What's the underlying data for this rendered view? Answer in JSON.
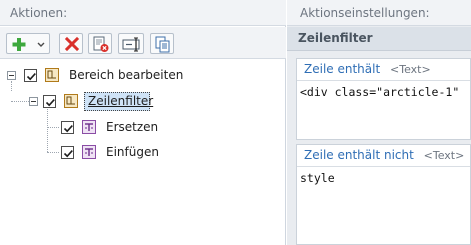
{
  "left": {
    "header": "Aktionen:",
    "tree": {
      "root": {
        "label": "Bereich bearbeiten",
        "checked": true,
        "expanded": true
      },
      "child": {
        "label": "Zeilenfilter",
        "checked": true,
        "expanded": true,
        "selected": true
      },
      "grandchildren": [
        {
          "label": "Ersetzen",
          "checked": true
        },
        {
          "label": "Einfügen",
          "checked": true
        }
      ]
    },
    "toolbar": [
      {
        "name": "add-dropdown",
        "icon": "plus-icon"
      },
      {
        "name": "delete",
        "icon": "red-x-icon"
      },
      {
        "name": "delete-all",
        "icon": "document-delete-icon"
      },
      {
        "name": "rename",
        "icon": "text-cursor-icon"
      },
      {
        "name": "copy",
        "icon": "copy-icon"
      }
    ]
  },
  "right": {
    "header": "Aktionseinstellungen:",
    "section_title": "Zeilenfilter",
    "fields": [
      {
        "label": "Zeile enthält",
        "hint": "<Text>",
        "value": "<div class=\"arcticle-1\""
      },
      {
        "label": "Zeile enthält nicht",
        "hint": "<Text>",
        "value": "style"
      }
    ]
  },
  "colors": {
    "accent_link": "#2f6eb5",
    "selection": "#cfe3f7",
    "add_green": "#3da83d",
    "delete_red": "#d9302b"
  }
}
